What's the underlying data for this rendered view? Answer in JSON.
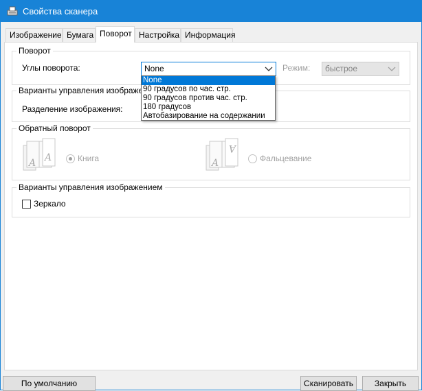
{
  "window": {
    "title": "Свойства сканера"
  },
  "tabs": [
    {
      "label": "Изображение"
    },
    {
      "label": "Бумага"
    },
    {
      "label": "Поворот"
    },
    {
      "label": "Настройка"
    },
    {
      "label": "Информация"
    }
  ],
  "rotation_group": {
    "title": "Поворот",
    "angle_label": "Углы поворота:",
    "angle_value": "None",
    "mode_label": "Режим:",
    "mode_value": "быстрое"
  },
  "angle_options": [
    "None",
    "90 градусов по час. стр.",
    "90 градусов против час. стр.",
    "180 градусов",
    "Автобазирование на содержании"
  ],
  "image_split_group": {
    "title": "Варианты управления изображе",
    "split_label": "Разделение изображения:"
  },
  "back_rotation_group": {
    "title": "Обратный поворот",
    "book_label": "Книга",
    "fold_label": "Фальцевание"
  },
  "image_options_group": {
    "title": "Варианты управления изображением",
    "mirror_label": "Зеркало"
  },
  "buttons": {
    "default_label": "По умолчанию",
    "scan_label": "Сканировать",
    "close_label": "Закрыть"
  }
}
